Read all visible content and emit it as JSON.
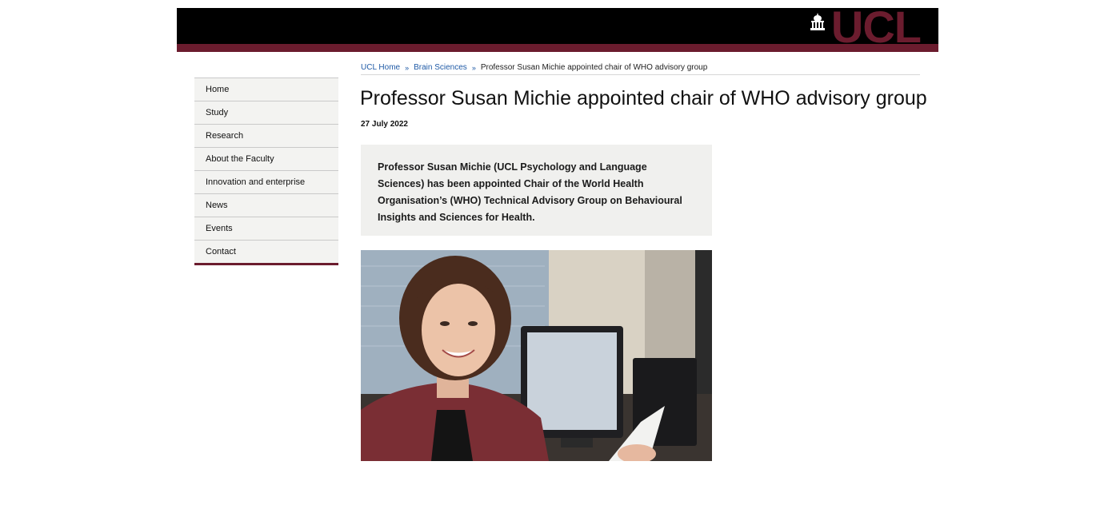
{
  "header": {
    "logo_text": "UCL",
    "brand_color": "#6b1c2e",
    "logo_icon": "portico-icon"
  },
  "breadcrumb": {
    "items": [
      "UCL Home",
      "Brain Sciences",
      "Professor Susan Michie appointed chair of WHO advisory group"
    ],
    "separator": "»"
  },
  "sidebar": {
    "items": [
      {
        "label": "Home"
      },
      {
        "label": "Study"
      },
      {
        "label": "Research"
      },
      {
        "label": "About the Faculty"
      },
      {
        "label": "Innovation and enterprise"
      },
      {
        "label": "News"
      },
      {
        "label": "Events"
      },
      {
        "label": "Contact"
      }
    ]
  },
  "article": {
    "title": "Professor Susan Michie appointed chair of WHO advisory group",
    "date": "27 July 2022",
    "summary": "Professor Susan Michie (UCL Psychology and Language Sciences) has been appointed Chair of the World Health Organisation’s (WHO) Technical Advisory Group on Behavioural Insights and Sciences for Health."
  }
}
